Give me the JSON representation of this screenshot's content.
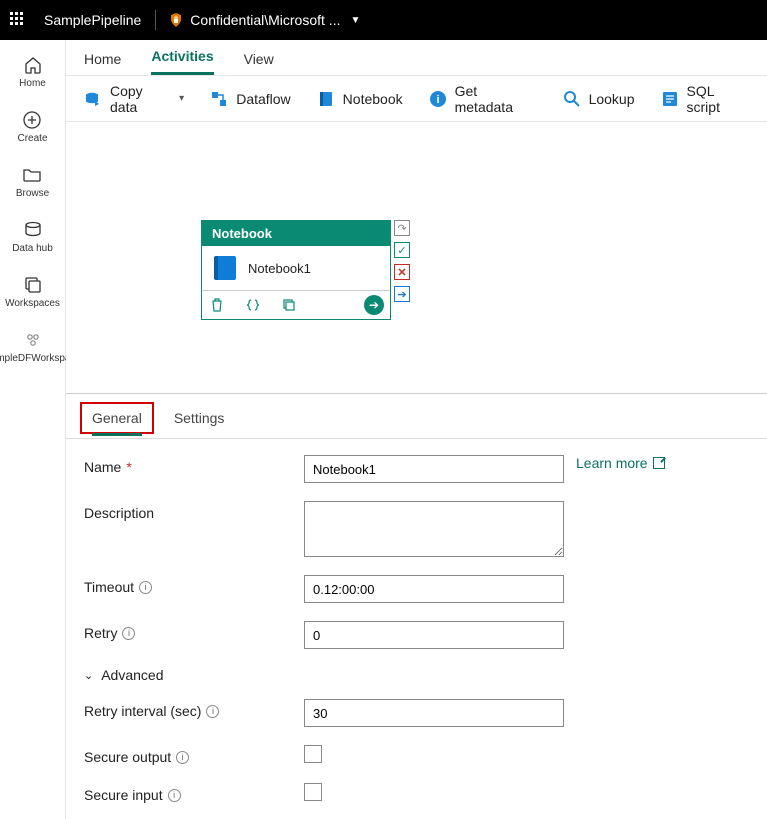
{
  "topbar": {
    "pipeline_name": "SamplePipeline",
    "sensitivity_label": "Confidential\\Microsoft ..."
  },
  "leftnav": [
    {
      "label": "Home"
    },
    {
      "label": "Create"
    },
    {
      "label": "Browse"
    },
    {
      "label": "Data hub"
    },
    {
      "label": "Workspaces"
    },
    {
      "label": "SampleDFWorkspace"
    }
  ],
  "tabs": [
    {
      "label": "Home"
    },
    {
      "label": "Activities",
      "active": true
    },
    {
      "label": "View"
    }
  ],
  "ribbon": [
    {
      "label": "Copy data",
      "dropdown": true
    },
    {
      "label": "Dataflow"
    },
    {
      "label": "Notebook"
    },
    {
      "label": "Get metadata"
    },
    {
      "label": "Lookup"
    },
    {
      "label": "SQL script"
    }
  ],
  "canvas_node": {
    "type_label": "Notebook",
    "title": "Notebook1"
  },
  "prop_tabs": [
    {
      "label": "General",
      "active": true,
      "highlighted": true
    },
    {
      "label": "Settings"
    }
  ],
  "form": {
    "name_label": "Name",
    "name_value": "Notebook1",
    "learn_more": "Learn more",
    "description_label": "Description",
    "description_value": "",
    "timeout_label": "Timeout",
    "timeout_value": "0.12:00:00",
    "retry_label": "Retry",
    "retry_value": "0",
    "advanced_label": "Advanced",
    "retry_interval_label": "Retry interval (sec)",
    "retry_interval_value": "30",
    "secure_output_label": "Secure output",
    "secure_input_label": "Secure input"
  }
}
